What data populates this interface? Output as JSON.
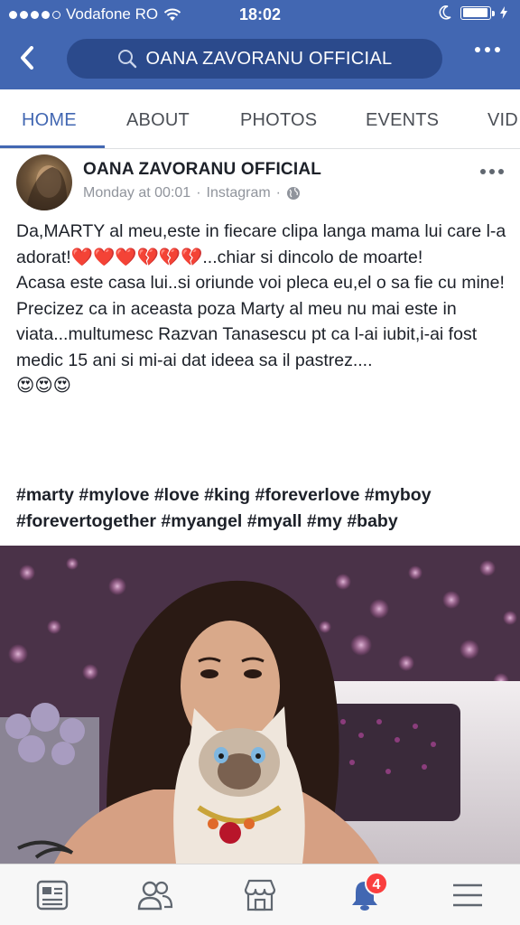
{
  "status_bar": {
    "carrier": "Vodafone RO",
    "time": "18:02",
    "signal_bars": 4,
    "battery_level": 0.95
  },
  "nav": {
    "back_icon": "chevron-left-icon",
    "search_text": "OANA ZAVORANU OFFICIAL",
    "more_icon": "more-dots-icon"
  },
  "tabs": [
    {
      "label": "HOME",
      "active": true
    },
    {
      "label": "ABOUT",
      "active": false
    },
    {
      "label": "PHOTOS",
      "active": false
    },
    {
      "label": "EVENTS",
      "active": false
    },
    {
      "label": "VID",
      "active": false
    }
  ],
  "post": {
    "author": "OANA ZAVORANU OFFICIAL",
    "time": "Monday at 00:01",
    "separator": "·",
    "source": "Instagram",
    "privacy_icon": "globe-icon",
    "lines": [
      "Da,MARTY al meu,este in fiecare clipa langa mama lui care l-a adorat!❤️❤️❤️💔💔💔...chiar si dincolo de moarte!",
      "Acasa este casa lui..si oriunde voi pleca eu,el o sa fie cu mine!",
      "Precizez ca in aceasta poza Marty al meu nu mai este in viata...multumesc Razvan Tanasescu pt ca l-ai iubit,i-ai fost medic 15 ani si mi-ai dat ideea sa il pastrez....",
      "😍😍😍"
    ],
    "hashtags": "#marty #mylove #love #king #foreverlove #myboy #forevertogether #myangel #myall #my #baby"
  },
  "bottom_bar": {
    "items": [
      {
        "icon": "news-feed-icon"
      },
      {
        "icon": "friends-icon"
      },
      {
        "icon": "marketplace-icon"
      },
      {
        "icon": "notifications-bell-icon",
        "badge": "4"
      },
      {
        "icon": "menu-icon"
      }
    ]
  },
  "colors": {
    "brand": "#4267b2",
    "badge": "#fa3e3e"
  }
}
